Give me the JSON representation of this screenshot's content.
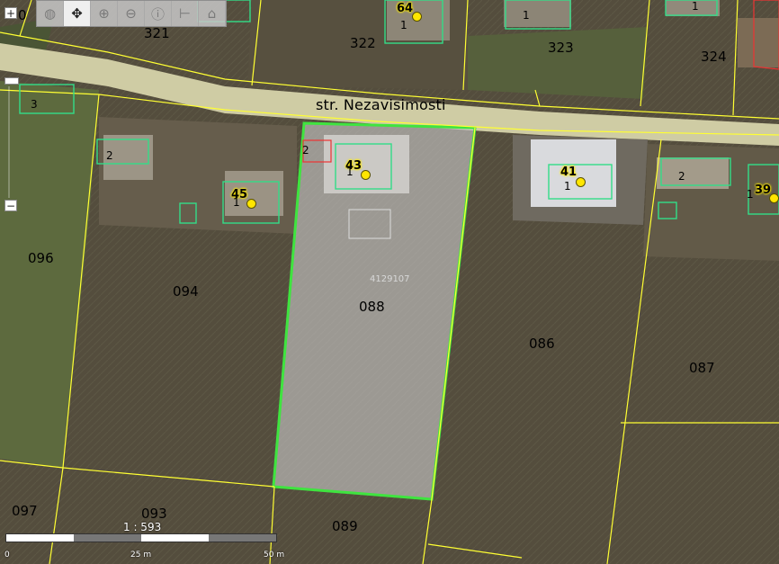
{
  "street": "str. Nezavisimosti",
  "cadastral_id": "4129107",
  "parcels": [
    "321",
    "322",
    "323",
    "324",
    "096",
    "094",
    "088",
    "086",
    "087",
    "097",
    "093",
    "089",
    "0"
  ],
  "houses": [
    {
      "number": "64",
      "sub": "1"
    },
    {
      "number": "43",
      "sub": "1"
    },
    {
      "number": "45",
      "sub": "1"
    },
    {
      "number": "41",
      "sub": "1"
    },
    {
      "number": "39",
      "sub": "1"
    }
  ],
  "subs": [
    "1",
    "1",
    "3",
    "2",
    "2",
    "2"
  ],
  "scale": {
    "ratio": "1 : 593",
    "labels": [
      "0",
      "25 m",
      "50 m"
    ]
  },
  "toolbar": {
    "tools": [
      "globe-icon",
      "pan-icon",
      "zoom-in-icon",
      "zoom-out-icon",
      "info-icon",
      "measure-icon",
      "building-icon"
    ]
  },
  "zoom": {
    "in": "+",
    "out": "−"
  }
}
